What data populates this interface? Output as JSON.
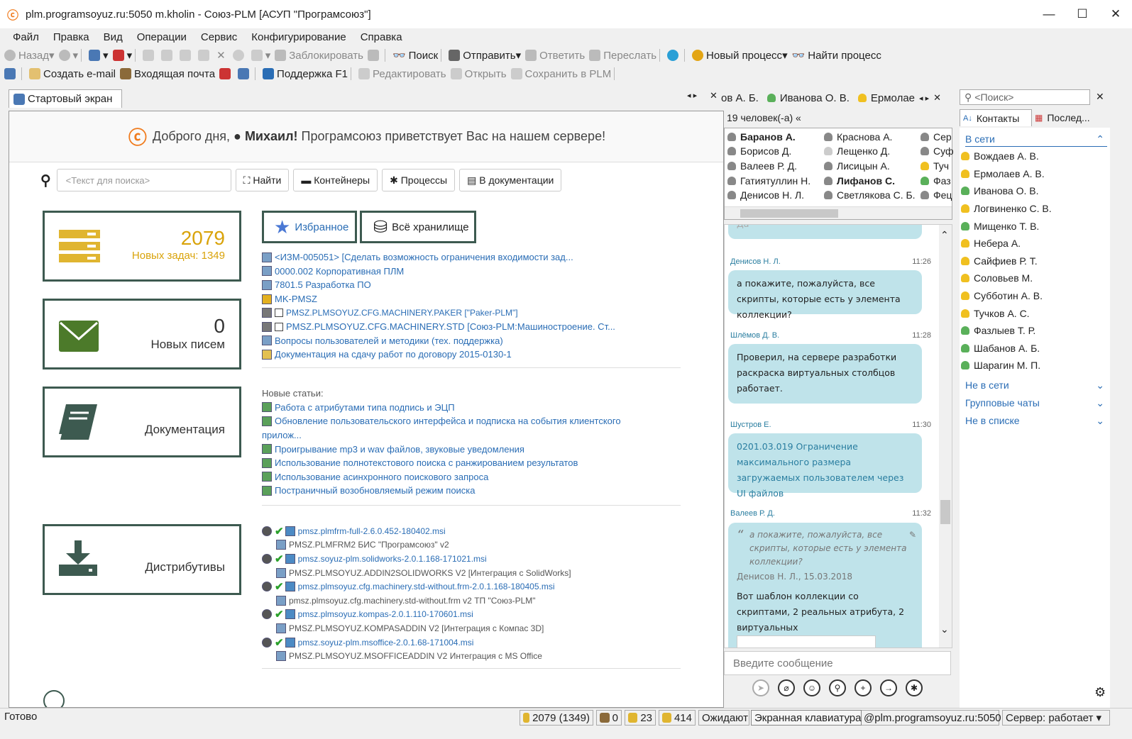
{
  "window": {
    "title": "plm.programsoyuz.ru:5050 m.kholin - Союз-PLM [АСУП \"Програмсоюз\"]",
    "min": "—",
    "max": "☐",
    "close": "✕"
  },
  "menu": [
    "Файл",
    "Правка",
    "Вид",
    "Операции",
    "Сервис",
    "Конфигурирование",
    "Справка"
  ],
  "toolbar1": {
    "back": "Назад",
    "lock": "Заблокировать",
    "search": "Поиск",
    "send": "Отправить",
    "reply": "Ответить",
    "forward": "Переслать",
    "new_process": "Новый процесс",
    "find_process": "Найти процесс"
  },
  "toolbar2": {
    "create_email": "Создать e-mail",
    "inbox": "Входящая почта",
    "support": "Поддержка F1",
    "edit": "Редактировать",
    "open": "Открыть",
    "save_plm": "Сохранить в PLM"
  },
  "tab": {
    "label": "Стартовый экран"
  },
  "welcome": {
    "prefix": "Доброго дня,",
    "name": "Михаил!",
    "suffix": "Програмсоюз приветствует Вас на нашем сервере!"
  },
  "search": {
    "placeholder": "<Текст для поиска>",
    "find": "Найти",
    "containers": "Контейнеры",
    "processes": "Процессы",
    "in_docs": "В документации"
  },
  "tiles": {
    "tasks_count": "2079",
    "tasks_label": "Новых задач: 1349",
    "mail_count": "0",
    "mail_label": "Новых писем",
    "docs_label": "Документация",
    "dist_label": "Дистрибутивы"
  },
  "pills": {
    "favorites": "Избранное",
    "all_storage": "Всё хранилище"
  },
  "favorites": [
    "<ИЗМ-005051> [Сделать возможность ограничения входимости зад...",
    "0000.002 Корпоративная ПЛМ",
    "7801.5 Разработка ПО",
    "MK-PMSZ",
    "PMSZ.PLMSOYUZ.CFG.MACHINERY.PAKER [\"Paker-PLM\"]",
    "PMSZ.PLMSOYUZ.CFG.MACHINERY.STD [Союз-PLM:Машиностроение. Ст...",
    "Вопросы пользователей и методики (тех. поддержка)",
    "Документация на сдачу работ по договору 2015-0130-1"
  ],
  "articles": {
    "heading": "Новые статьи:",
    "items": [
      "Работа с атрибутами типа подпись и ЭЦП",
      "Обновление пользовательского интерфейса и подписка на события клиентского",
      "прилож...",
      "Проигрывание mp3 и wav файлов, звуковые уведомления",
      "Использование полнотекстового поиска с ранжированием результатов",
      "Использование асинхронного поискового запроса",
      "Постраничный возобновляемый режим поиска"
    ]
  },
  "distributions": [
    "pmsz.plmfrm-full-2.6.0.452-180402.msi",
    "PMSZ.PLMFRM2 БИС \"Програмсоюз\" v2",
    "pmsz.soyuz-plm.solidworks-2.0.1.168-171021.msi",
    "PMSZ.PLMSOYUZ.ADDIN2SOLIDWORKS V2 [Интеграция с SolidWorks]",
    "pmsz.plmsoyuz.cfg.machinery.std-without.frm-2.0.1.168-180405.msi",
    "pmsz.plmsoyuz.cfg.machinery.std-without.frm v2 ТП \"Союз-PLM\"",
    "pmsz.plmsoyuz.kompas-2.0.1.110-170601.msi",
    "PMSZ.PLMSOYUZ.KOMPASADDIN V2 [Интеграция с Компас 3D]",
    "pmsz.soyuz-plm.msoffice-2.0.1.68-171004.msi",
    "PMSZ.PLMSOYUZ.MSOFFICEADDIN V2 Интеграция с MS Office"
  ],
  "chat_tabs": [
    "ов А. Б.",
    "Иванова О. В.",
    "Ермолае"
  ],
  "group": {
    "count": "19 человек(-а) «"
  },
  "members": [
    [
      "Баранов А.",
      "Борисов Д.",
      "Валеев Р. Д.",
      "Гатиятуллин Н.",
      "Денисов Н. Л."
    ],
    [
      "Краснова А.",
      "Лещенко Д.",
      "Лисицын А.",
      "Лифанов С.",
      "Светлякова С. Б."
    ],
    [
      "Сер",
      "Суф",
      "Туч",
      "Фаз",
      "Фец"
    ]
  ],
  "chat": {
    "faded": "Да",
    "messages": [
      {
        "author": "Денисов Н. Л.",
        "time": "11:26",
        "text": "а покажите, пожалуйста, все скрипты, которые есть у элемента коллекции?"
      },
      {
        "author": "Шлёмов Д. В.",
        "time": "11:28",
        "text": "Проверил,  на сервере разработки раскраска виртуальных столбцов работает."
      },
      {
        "author": "Шустров Е.",
        "time": "11:30",
        "text": "0201.03.019 Ограничение максимального размера загружаемых пользователем через UI файлов"
      },
      {
        "author": "Валеев Р. Д.",
        "time": "11:32",
        "quote": "а покажите, пожалуйста, все скрипты, которые есть у элемента коллекции?",
        "quote_src": "Денисов Н. Л., 15.03.2018",
        "text": "Вот шаблон коллекции со скриптами, 2 реальных атрибута, 2 виртуальных"
      }
    ],
    "input_placeholder": "Введите сообщение"
  },
  "contacts": {
    "search": "<Поиск>",
    "tab_contacts": "Контакты",
    "tab_recent": "Послед...",
    "online": "В сети",
    "list": [
      "Вождаев А. В.",
      "Ермолаев А. В.",
      "Иванова О. В.",
      "Логвиненко С. В.",
      "Мищенко Т. В.",
      "Небера А.",
      "Сайфиев Р. Т.",
      "Соловьев М.",
      "Субботин А. В.",
      "Тучков А. С.",
      "Фазлыев Т. Р.",
      "Шабанов А. Б.",
      "Шарагин М. П."
    ],
    "offline": "Не в сети",
    "group_chats": "Групповые чаты",
    "not_in_list": "Не в списке"
  },
  "status": {
    "ready": "Готово",
    "tasks": "2079 (1349)",
    "s1": "0",
    "s2": "23",
    "s3": "414",
    "waiting": "Ожидают з",
    "tooltip": "Экранная клавиатура",
    "server_addr": "@plm.programsoyuz.ru:5050",
    "server_state": "Сервер: работает"
  },
  "colors": {
    "accent": "#d9a30a",
    "tile_border": "#3d5a50",
    "link": "#2a6db5",
    "bubble": "#bfe3ea"
  }
}
